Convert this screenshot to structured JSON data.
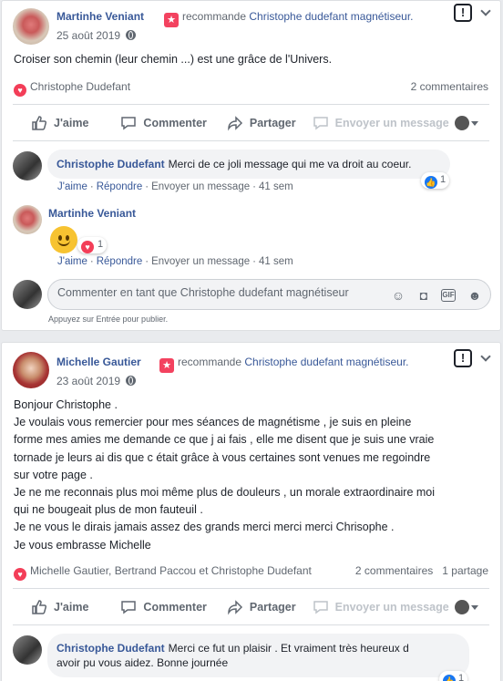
{
  "post1": {
    "author": "Martinhe Veniant",
    "recommend_text": "recommande",
    "page": "Christophe dudefant magnétiseur.",
    "date": "25 août 2019",
    "body": "Croiser son chemin (leur chemin ...) est une grâce de l'Univers.",
    "reactors": "Christophe Dudefant",
    "comments_count": "2 commentaires",
    "actions": {
      "like": "J'aime",
      "comment": "Commenter",
      "share": "Partager",
      "message": "Envoyer un message"
    },
    "comments": [
      {
        "author": "Christophe Dudefant",
        "text": "Merci de ce joli message qui me va droit au coeur.",
        "meta": {
          "like": "J'aime",
          "reply": "Répondre",
          "message": "Envoyer un message",
          "time": "41 sem"
        },
        "reaction_count": "1"
      },
      {
        "author": "Martinhe Veniant",
        "meta": {
          "like": "J'aime",
          "reply": "Répondre",
          "message": "Envoyer un message",
          "time": "41 sem"
        },
        "reaction_count": "1"
      }
    ],
    "compose_placeholder": "Commenter en tant que Christophe dudefant magnétiseur",
    "hint": "Appuyez sur Entrée pour publier."
  },
  "post2": {
    "author": "Michelle Gautier",
    "recommend_text": "recommande",
    "page": "Christophe dudefant magnétiseur.",
    "date": "23 août 2019",
    "body_lines": [
      "Bonjour Christophe .",
      "Je voulais vous remercier pour mes séances de magnétisme , je suis en pleine",
      "forme mes amies me demande ce que j ai fais , elle me disent que je suis une vraie",
      "tornade je leurs ai dis que c était grâce à vous certaines sont venues me regoindre",
      "sur votre page .",
      "Je ne me reconnais plus moi même plus de douleurs , un morale extraordinaire moi",
      "qui ne bougeait plus de mon fauteuil .",
      "Je ne vous le dirais jamais assez des grands merci merci merci Chrisophe .",
      "Je vous embrasse Michelle"
    ],
    "reactors": "Michelle Gautier, Bertrand Paccou et Christophe Dudefant",
    "comments_count": "2 commentaires",
    "shares_count": "1 partage",
    "actions": {
      "like": "J'aime",
      "comment": "Commenter",
      "share": "Partager",
      "message": "Envoyer un message"
    },
    "comment": {
      "author": "Christophe Dudefant",
      "text_line1": "Merci ce fut un plaisir . Et vraiment très heureux d",
      "text_line2": "avoir pu vous aidez. Bonne journée",
      "reaction_count": "1"
    }
  },
  "colors": {
    "link": "#385898",
    "accent": "#1877f2",
    "heart": "#f33e58",
    "badge": "#f3425f"
  }
}
